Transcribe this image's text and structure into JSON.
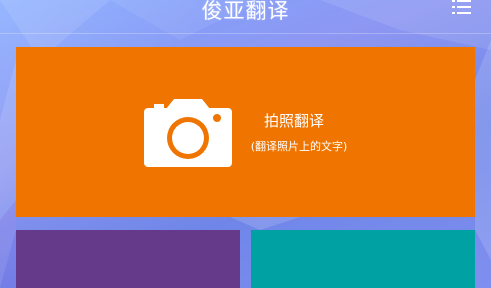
{
  "header": {
    "title": "俊亚翻译",
    "menu_icon": "list-menu-icon"
  },
  "tiles": {
    "photo_translate": {
      "title": "拍照翻译",
      "subtitle": "(翻译照片上的文字)",
      "icon": "camera-icon",
      "color": "#ef7400"
    },
    "tile_2": {
      "color": "#653a8a"
    },
    "tile_3": {
      "color": "#00a1a3"
    }
  },
  "theme": {
    "background": "#7f95f0",
    "icon_color": "#ffffff"
  }
}
